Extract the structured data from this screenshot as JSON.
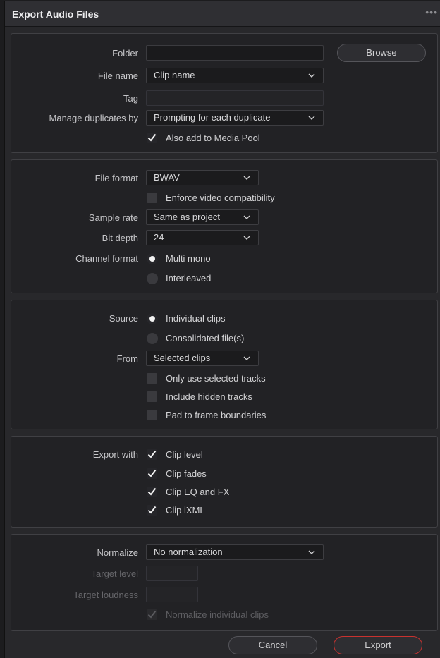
{
  "window": {
    "title": "Export Audio Files",
    "menu_icon": "more-dots-icon"
  },
  "location": {
    "folder_label": "Folder",
    "folder_value": "",
    "browse_label": "Browse",
    "filename_label": "File name",
    "filename_value": "Clip name",
    "tag_label": "Tag",
    "tag_value": "",
    "duplicates_label": "Manage duplicates by",
    "duplicates_value": "Prompting for each duplicate",
    "media_pool_label": "Also add to Media Pool",
    "media_pool_checked": true
  },
  "format": {
    "file_format_label": "File format",
    "file_format_value": "BWAV",
    "enforce_label": "Enforce video compatibility",
    "enforce_checked": false,
    "sample_rate_label": "Sample rate",
    "sample_rate_value": "Same as project",
    "bit_depth_label": "Bit depth",
    "bit_depth_value": "24",
    "channel_label": "Channel format",
    "channel_options": [
      "Multi mono",
      "Interleaved"
    ],
    "channel_selected": "Multi mono"
  },
  "source": {
    "source_label": "Source",
    "source_options": [
      "Individual clips",
      "Consolidated file(s)"
    ],
    "source_selected": "Individual clips",
    "from_label": "From",
    "from_value": "Selected clips",
    "only_selected_label": "Only use selected tracks",
    "hidden_tracks_label": "Include hidden tracks",
    "pad_label": "Pad to frame boundaries"
  },
  "export_with": {
    "label": "Export with",
    "options": [
      "Clip level",
      "Clip fades",
      "Clip EQ and FX",
      "Clip iXML"
    ],
    "all_checked": true
  },
  "normalize": {
    "label": "Normalize",
    "value": "No normalization",
    "target_level_label": "Target level",
    "target_loudness_label": "Target loudness",
    "individual_label": "Normalize individual clips",
    "individual_checked": true,
    "individual_enabled": false
  },
  "footer": {
    "cancel_label": "Cancel",
    "export_label": "Export"
  },
  "colors": {
    "accent_export": "#c8322f",
    "panel": "#222225",
    "window": "#28282b"
  }
}
